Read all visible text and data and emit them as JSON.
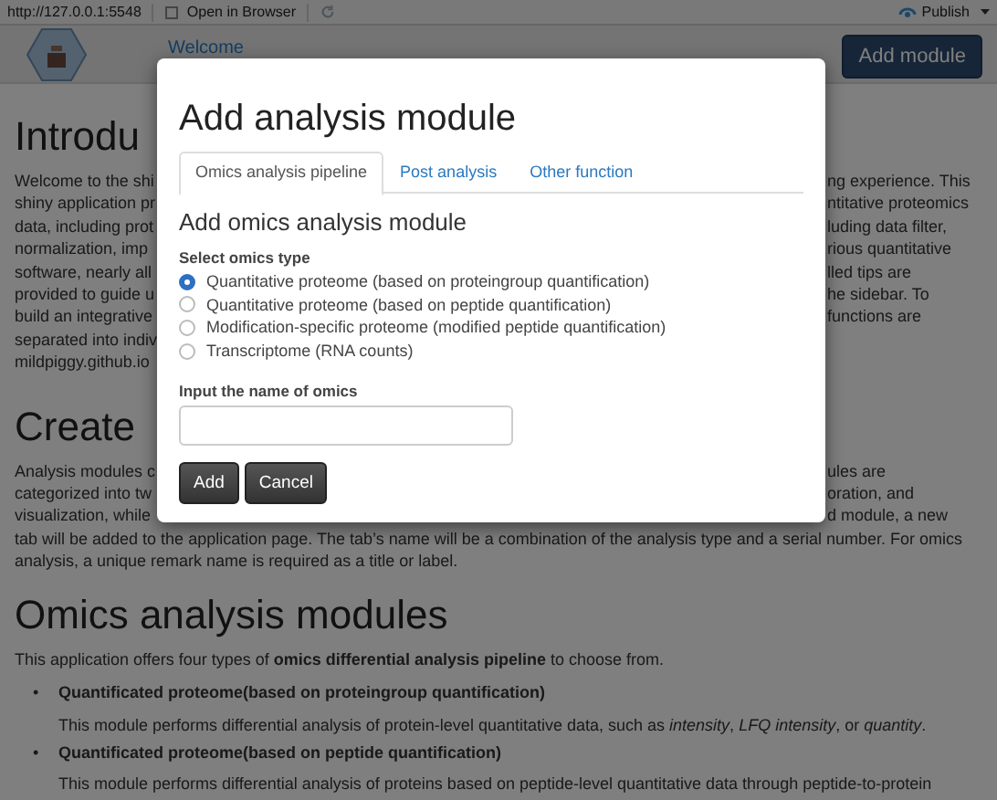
{
  "browser_bar": {
    "url": "http://127.0.0.1:5548",
    "open_button": "Open in Browser",
    "publish_button": "Publish"
  },
  "navbar": {
    "tab": "Welcome",
    "add_button": "Add module"
  },
  "page": {
    "sections": [
      {
        "heading": "Introdu",
        "lines": [
          {
            "left": "Welcome to the shi",
            "right": "ng experience. This"
          },
          {
            "left": "shiny application pr",
            "right": "ntitative proteomics"
          },
          {
            "left": "data, including prot",
            "right": "luding data filter,"
          },
          {
            "left": "normalization, imp",
            "right": "rious quantitative"
          },
          {
            "left": "software, nearly all",
            "right": "lled tips are"
          },
          {
            "left": "provided to guide u",
            "right": "he sidebar. To"
          },
          {
            "left": "build an integrative",
            "right": "functions are"
          },
          {
            "left": "separated into indiv"
          },
          {
            "left": "mildpiggy.github.io"
          }
        ]
      },
      {
        "heading": "Create",
        "lines": [
          {
            "left": "Analysis modules c",
            "right": "ules are"
          },
          {
            "left": "categorized into tw",
            "right": "oration, and"
          },
          {
            "left": "visualization, while",
            "right": "d module, a new"
          },
          {
            "left": "tab will be added to the application page. The tab’s name will be a combination of the analysis type and a serial number. For omics"
          },
          {
            "left": "analysis, a unique remark name is required as a title or label."
          }
        ]
      }
    ],
    "omics": {
      "heading": "Omics analysis modules",
      "intro": "This application offers four types of **omics differential analysis pipeline** to choose from.",
      "items": [
        {
          "marker": "•",
          "title": "Quantificated proteome(based on proteingroup quantification)",
          "description": "This module performs differential analysis of protein-level quantitative data, such as *intensity*, *LFQ intensity*, or *quantity*."
        },
        {
          "marker": "•",
          "title": "Quantificated proteome(based on peptide quantification)",
          "description": "This module performs differential analysis of proteins based on peptide-level quantitative data through peptide-to-protein"
        }
      ]
    }
  },
  "modal": {
    "title": "Add analysis module",
    "tabs": [
      {
        "label": "Omics analysis pipeline",
        "selected": true
      },
      {
        "label": "Post analysis",
        "selected": false
      },
      {
        "label": "Other function",
        "selected": false
      }
    ],
    "subtitle": "Add omics analysis module",
    "radio_label": "Select omics type",
    "options": [
      {
        "label": "Quantitative proteome (based on proteingroup quantification)",
        "selected": true
      },
      {
        "label": "Quantitative proteome (based on peptide quantification)",
        "selected": false
      },
      {
        "label": "Modification-specific proteome (modified peptide quantification)",
        "selected": false
      },
      {
        "label": "Transcriptome (RNA counts)",
        "selected": false
      }
    ],
    "name_label": "Input the name of omics",
    "buttons": [
      "Add",
      "Cancel"
    ]
  }
}
